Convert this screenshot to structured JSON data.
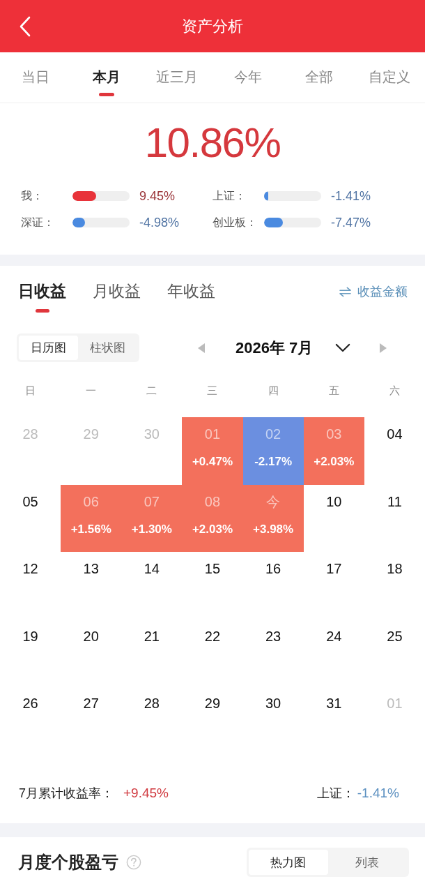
{
  "header": {
    "title": "资产分析"
  },
  "period_tabs": [
    {
      "label": "当日",
      "selected": false
    },
    {
      "label": "本月",
      "selected": true
    },
    {
      "label": "近三月",
      "selected": false
    },
    {
      "label": "今年",
      "selected": false
    },
    {
      "label": "全部",
      "selected": false
    },
    {
      "label": "自定义",
      "selected": false
    }
  ],
  "overview": {
    "total_return": "10.86%",
    "comparisons": [
      {
        "label": "我：",
        "level": 0.41,
        "value": "9.45%",
        "color": "#e8333a"
      },
      {
        "label": "上证：",
        "level": 0.07,
        "value": "-1.41%",
        "color": "#4a8ae0"
      },
      {
        "label": "深证：",
        "level": 0.22,
        "value": "-4.98%",
        "color": "#4a8ae0"
      },
      {
        "label": "创业板：",
        "level": 0.33,
        "value": "-7.47%",
        "color": "#4a8ae0"
      }
    ]
  },
  "returns": {
    "tabs": [
      {
        "label": "日收益",
        "selected": true
      },
      {
        "label": "月收益",
        "selected": false
      },
      {
        "label": "年收益",
        "selected": false
      }
    ],
    "amount_toggle": "收益金额",
    "views": [
      {
        "label": "日历图",
        "selected": true
      },
      {
        "label": "柱状图",
        "selected": false
      }
    ],
    "month": "2026年 7月",
    "weekdays": [
      "日",
      "一",
      "二",
      "三",
      "四",
      "五",
      "六"
    ],
    "weeks": [
      {
        "days": [
          {
            "day": "28",
            "other_month": true
          },
          {
            "day": "29",
            "other_month": true
          },
          {
            "day": "30",
            "other_month": true
          },
          {
            "day": "01",
            "other_month": false,
            "change": "+0.47%",
            "color": "#f3705c"
          },
          {
            "day": "02",
            "other_month": false,
            "change": "-2.17%",
            "color": "#6b8fe0"
          },
          {
            "day": "03",
            "other_month": false,
            "change": "+2.03%",
            "color": "#f3705c"
          },
          {
            "day": "04",
            "other_month": false
          }
        ]
      },
      {
        "days": [
          {
            "day": "05",
            "other_month": false
          },
          {
            "day": "06",
            "other_month": false,
            "change": "+1.56%",
            "color": "#f3705c"
          },
          {
            "day": "07",
            "other_month": false,
            "change": "+1.30%",
            "color": "#f3705c"
          },
          {
            "day": "08",
            "other_month": false,
            "change": "+2.03%",
            "color": "#f3705c"
          },
          {
            "day": "今",
            "other_month": false,
            "change": "+3.98%",
            "color": "#f3705c"
          },
          {
            "day": "10",
            "other_month": false
          },
          {
            "day": "11",
            "other_month": false
          }
        ]
      },
      {
        "days": [
          {
            "day": "12",
            "other_month": false
          },
          {
            "day": "13",
            "other_month": false
          },
          {
            "day": "14",
            "other_month": false
          },
          {
            "day": "15",
            "other_month": false
          },
          {
            "day": "16",
            "other_month": false
          },
          {
            "day": "17",
            "other_month": false
          },
          {
            "day": "18",
            "other_month": false
          }
        ]
      },
      {
        "days": [
          {
            "day": "19",
            "other_month": false
          },
          {
            "day": "20",
            "other_month": false
          },
          {
            "day": "21",
            "other_month": false
          },
          {
            "day": "22",
            "other_month": false
          },
          {
            "day": "23",
            "other_month": false
          },
          {
            "day": "24",
            "other_month": false
          },
          {
            "day": "25",
            "other_month": false
          }
        ]
      },
      {
        "days": [
          {
            "day": "26",
            "other_month": false
          },
          {
            "day": "27",
            "other_month": false
          },
          {
            "day": "28",
            "other_month": false
          },
          {
            "day": "29",
            "other_month": false
          },
          {
            "day": "30",
            "other_month": false
          },
          {
            "day": "31",
            "other_month": false
          },
          {
            "day": "01",
            "other_month": true
          }
        ]
      }
    ],
    "summary": [
      {
        "label": "7月累计收益率：",
        "value": "+9.45%",
        "kind": "gain"
      },
      {
        "label": "上证：",
        "value": "-1.41%",
        "kind": "loss"
      }
    ]
  },
  "stock_pnl": {
    "title": "月度个股盈亏",
    "views": [
      {
        "label": "热力图",
        "selected": true
      },
      {
        "label": "列表",
        "selected": false
      }
    ]
  }
}
